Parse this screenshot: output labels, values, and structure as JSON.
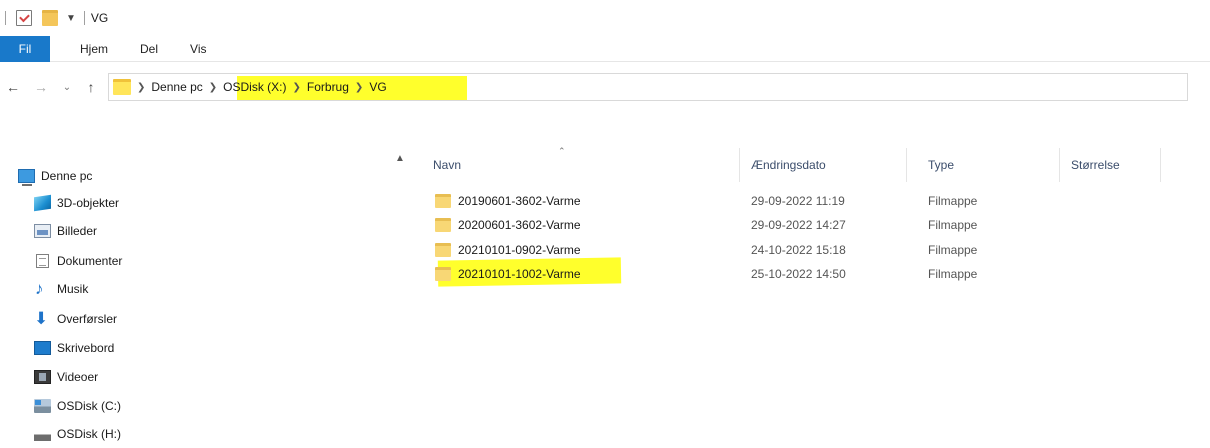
{
  "window": {
    "title": "VG"
  },
  "ribbon": {
    "tabs": [
      "Fil",
      "Hjem",
      "Del",
      "Vis"
    ]
  },
  "address": {
    "crumbs": [
      "Denne pc",
      "OSDisk (X:)",
      "Forbrug",
      "VG"
    ]
  },
  "highlight_color": "#ffff2c",
  "nav": {
    "items": [
      {
        "label": "Denne pc",
        "icon": "computer-icon"
      },
      {
        "label": "3D-objekter",
        "icon": "3d-objects-icon"
      },
      {
        "label": "Billeder",
        "icon": "pictures-icon"
      },
      {
        "label": "Dokumenter",
        "icon": "documents-icon"
      },
      {
        "label": "Musik",
        "icon": "music-icon"
      },
      {
        "label": "Overførsler",
        "icon": "downloads-icon"
      },
      {
        "label": "Skrivebord",
        "icon": "desktop-icon"
      },
      {
        "label": "Videoer",
        "icon": "videos-icon"
      },
      {
        "label": "OSDisk (C:)",
        "icon": "drive-c-icon"
      },
      {
        "label": "OSDisk (H:)",
        "icon": "drive-h-icon"
      }
    ]
  },
  "filelist": {
    "columns": {
      "name": "Navn",
      "date": "Ændringsdato",
      "type": "Type",
      "size": "Størrelse"
    },
    "rows": [
      {
        "name": "20190601-3602-Varme",
        "date": "29-09-2022 11:19",
        "type": "Filmappe"
      },
      {
        "name": "20200601-3602-Varme",
        "date": "29-09-2022 14:27",
        "type": "Filmappe"
      },
      {
        "name": "20210101-0902-Varme",
        "date": "24-10-2022 15:18",
        "type": "Filmappe"
      },
      {
        "name": "20210101-1002-Varme",
        "date": "25-10-2022 14:50",
        "type": "Filmappe"
      }
    ]
  }
}
